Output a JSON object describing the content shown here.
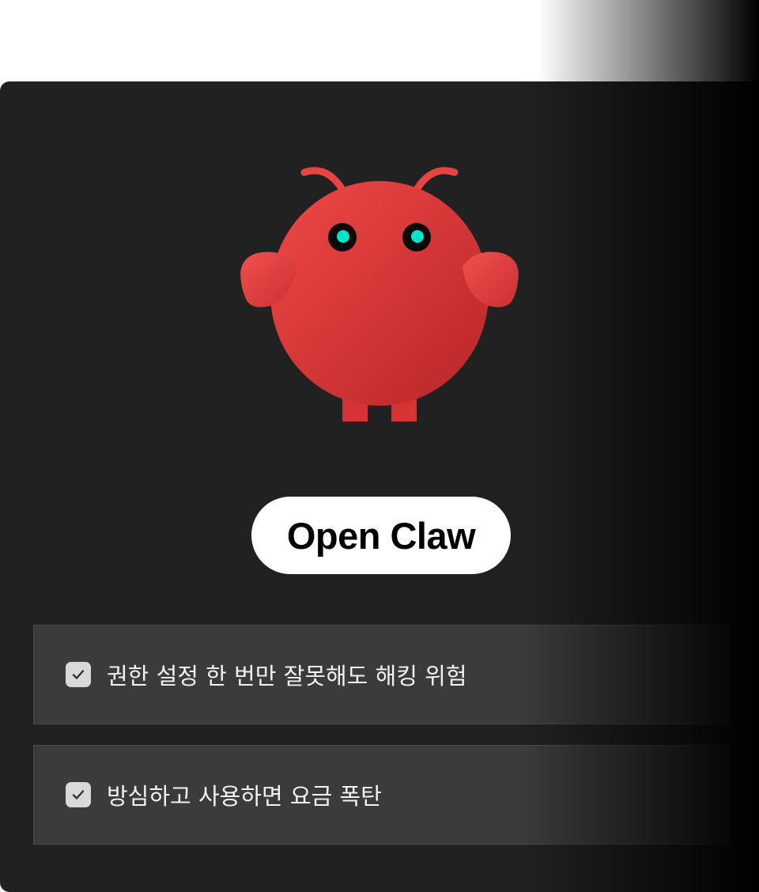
{
  "title": "Open Claw",
  "checklist": [
    {
      "label": "권한 설정 한 번만 잘못해도 해킹 위험",
      "checked": true
    },
    {
      "label": "방심하고 사용하면 요금 폭탄",
      "checked": true
    }
  ],
  "colors": {
    "background": "#212121",
    "mascot_red": "#e03c3c",
    "eye_accent": "#00e5c8",
    "row_background": "#3b3b3b",
    "pill_background": "#ffffff"
  },
  "icons": {
    "mascot": "red-lobster-mascot",
    "check": "check-icon"
  }
}
